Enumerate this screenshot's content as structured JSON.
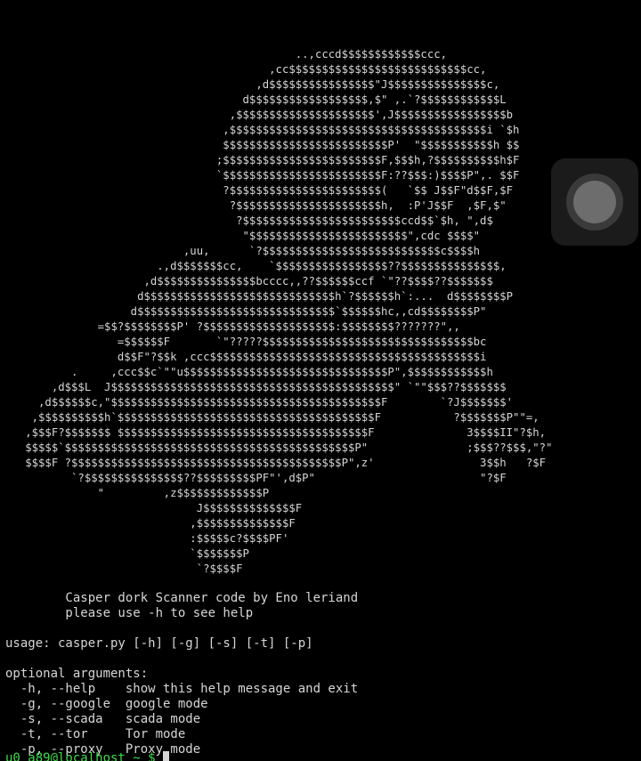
{
  "terminal": {
    "ascii_art": "                                            ..,cccd$$$$$$$$$$$$ccc,\n                                        ,cc$$$$$$$$$$$$$$$$$$$$$$$$$$$cc,\n                                      ,d$$$$$$$$$$$$$$$$\"J$$$$$$$$$$$$$$$c,\n                                    d$$$$$$$$$$$$$$$$$$,$\" ,.`?$$$$$$$$$$$$L\n                                  ,$$$$$$$$$$$$$$$$$$$$$',J$$$$$$$$$$$$$$$$$b\n                                 ,$$$$$$$$$$$$$$$$$$$$$$$$$$$$$$$$$$$$$$$i `$h\n                                 $$$$$$$$$$$$$$$$$$$$$$$$$P'  \"$$$$$$$$$$$h $$\n                                ;$$$$$$$$$$$$$$$$$$$$$$$$F,$$$h,?$$$$$$$$$$h$F\n                                `$$$$$$$$$$$$$$$$$$$$$$$$F:??$$$:)$$$$P\",. $$F\n                                 ?$$$$$$$$$$$$$$$$$$$$$$$(   `$$ J$$F\"d$$F,$F\n                                  ?$$$$$$$$$$$$$$$$$$$$$$h,  :P'J$$F  ,$F,$\"\n                                   ?$$$$$$$$$$$$$$$$$$$$$$$$ccd$$`$h, \",d$\n                                    \"$$$$$$$$$$$$$$$$$$$$$$$$\",cdc $$$$\"\n                           ,uu,      `?$$$$$$$$$$$$$$$$$$$$$$$$$$$c$$$$h\n                       .,d$$$$$$$cc,    `$$$$$$$$$$$$$$$$$??$$$$$$$$$$$$$$$,\n                     ,d$$$$$$$$$$$$$$$bcccc,,??$$$$$$ccf `\"??$$$$??$$$$$$$\n                    d$$$$$$$$$$$$$$$$$$$$$$$$$$$$$h`?$$$$$$h`:...  d$$$$$$$$P\n                   d$$$$$$$$$$$$$$$$$$$$$$$$$$$$$$`$$$$$$hc,,cd$$$$$$$$P\"\n              =$$?$$$$$$$$P' ?$$$$$$$$$$$$$$$$$$$$:$$$$$$$$???????\",,\n                 =$$$$$$F       `\"?????$$$$$$$$$$$$$$$$$$$$$$$$$$$$$$$$bc\n                 d$$F\"?$$k ,ccc$$$$$$$$$$$$$$$$$$$$$$$$$$$$$$$$$$$$$$$$$i\n          .     ,ccc$$c`\"\"u$$$$$$$$$$$$$$$$$$$$$$$$$$$$$$$P\",$$$$$$$$$$$$h\n       ,d$$$L  J$$$$$$$$$$$$$$$$$$$$$$$$$$$$$$$$$$$$$$$$$$$\" `\"\"$$$??$$$$$$$\n     ,d$$$$$$c,\"$$$$$$$$$$$$$$$$$$$$$$$$$$$$$$$$$$$$$$$$$F        `?J$$$$$$$'\n    ,$$$$$$$$$$h`$$$$$$$$$$$$$$$$$$$$$$$$$$$$$$$$$$$$$$$F           ?$$$$$$$P\"\"=,\n   ,$$$F?$$$$$$$ $$$$$$$$$$$$$$$$$$$$$$$$$$$$$$$$$$$$$$F              3$$$$II\"?$h,\n   $$$$$`$$$$$$$$$$$$$$$$$$$$$$$$$$$$$$$$$$$$$$$$$$$$P\"               ;$$$??$$$,\"?\"\n   $$$$F ?$$$$$$$$$$$$$$$$$$$$$$$$$$$$$$$$$$$$$$$$$P\",z'                3$$h   ?$F\n          `?$$$$$$$$$$$$$$$??$$$$$$$$$PF\"',d$P\"                         \"?$F\n              \"         ,z$$$$$$$$$$$$$P\n                             J$$$$$$$$$$$$$$F\n                            ,$$$$$$$$$$$$$$F\n                            :$$$$$c?$$$$PF'\n                            `$$$$$$$P\n                             `?$$$$F",
    "output_lines": "        Casper dork Scanner code by Eno leriand\n        please use -h to see help\n\nusage: casper.py [-h] [-g] [-s] [-t] [-p]\n\noptional arguments:\n  -h, --help    show this help message and exit\n  -g, --google  google mode\n  -s, --scada   scada mode\n  -t, --tor     Tor mode\n  -p, --proxy   Proxy mode",
    "prompt_partial": "u0_a89@localhost ~ $ "
  },
  "floating_button": {
    "icon": "circle-overlay-icon"
  },
  "colors": {
    "background": "#000000",
    "text": "#d6d6d6",
    "prompt": "#3ddc4a"
  }
}
